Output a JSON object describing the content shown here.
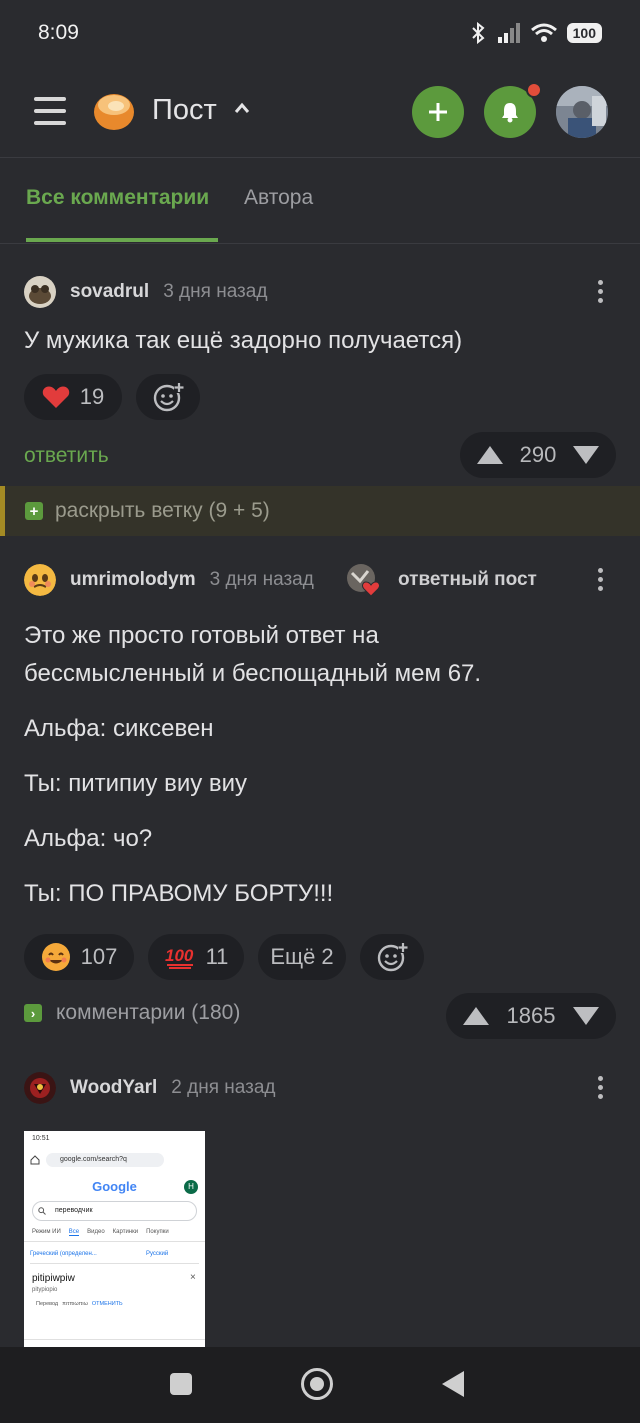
{
  "status": {
    "time": "8:09",
    "battery": "100"
  },
  "app": {
    "title": "Пост"
  },
  "tabs": [
    {
      "label": "Все комментарии"
    },
    {
      "label": "Автора"
    }
  ],
  "comments": [
    {
      "user": "sovadrul",
      "time": "3 дня назад",
      "text": "У мужика так ещё задорно получается)",
      "likes": "19",
      "reply_label": "ответить",
      "rating": "290"
    },
    {
      "user": "umrimolodym",
      "time": "3 дня назад",
      "answer_post_label": "ответный пост",
      "lines": [
        "Это же просто готовый ответ на",
        "бессмысленный и беспощадный мем 67.",
        "Альфа: сиксевен",
        "Ты: питипиу виу виу",
        "Альфа: чо?",
        "Ты: ПО ПРАВОМУ БОРТУ!!!"
      ],
      "reactions": [
        {
          "icon": "smiling-face-icon",
          "count": "107"
        },
        {
          "icon": "hundred-points-icon",
          "count": "11"
        }
      ],
      "more_label": "Ещё 2",
      "comments_label": "комментарии (180)",
      "rating": "1865"
    },
    {
      "user": "WoodYarl",
      "time": "2 дня назад"
    }
  ],
  "expand_label": "раскрыть ветку (9 + 5)",
  "thumb": {
    "status": "10:51",
    "url": "google.com/search?q",
    "logo": "Google",
    "avatar": "H",
    "query": "переводчик",
    "tabs": [
      "Режим ИИ",
      "Все",
      "Видео",
      "Картинки",
      "Покупки"
    ],
    "from_lang": "Греческий (определен...",
    "to_lang": "Русский",
    "input": "pitipiwpiw",
    "translit": "pitypiopio",
    "hint": "Перевод",
    "hint_word": "πιτπιωπιω",
    "cancel": "ОТМЕНИТЬ"
  },
  "colors": {
    "accent": "#6aa84f",
    "background": "#2a2b2f",
    "badge": "#e14d3a"
  }
}
